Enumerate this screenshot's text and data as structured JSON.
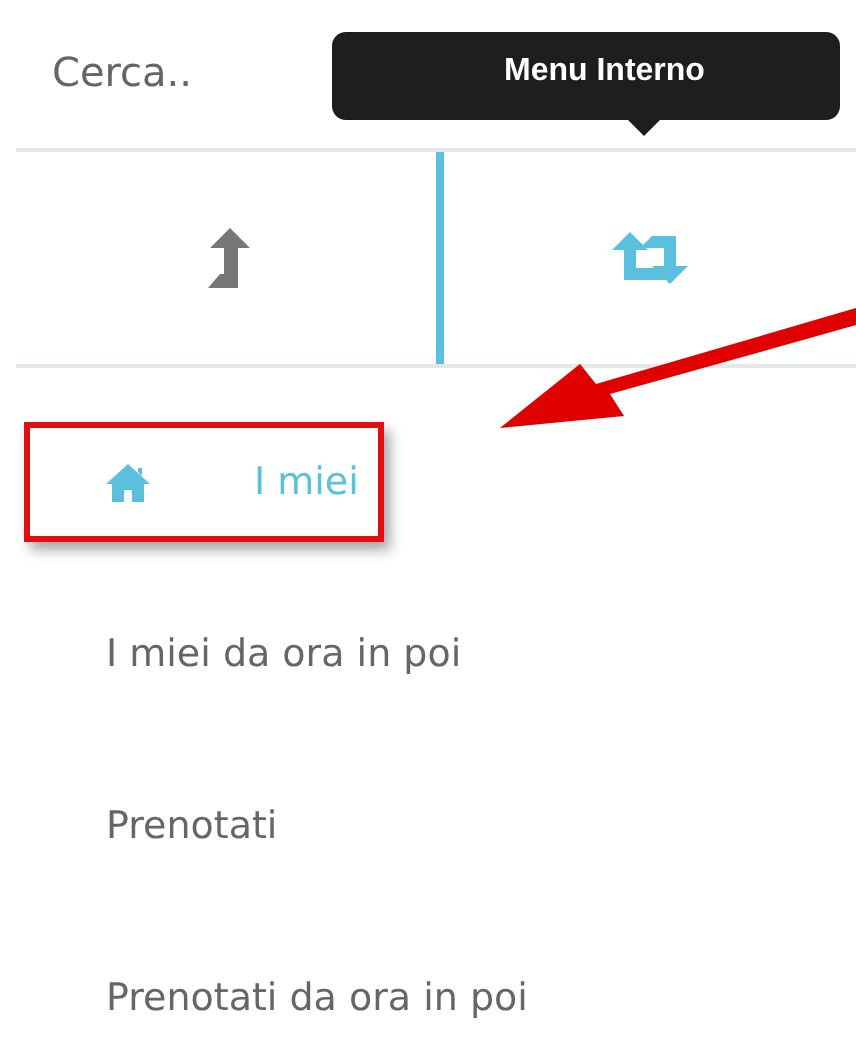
{
  "search": {
    "placeholder": "Cerca.."
  },
  "tooltip": {
    "text": "Menu Interno"
  },
  "tabs": [
    {
      "kind": "up",
      "selected": false
    },
    {
      "kind": "repeat",
      "selected": true
    }
  ],
  "menu": [
    {
      "label": "I miei",
      "kind": "home",
      "selected": true,
      "highlighted": true
    },
    {
      "label": "I miei da ora in poi",
      "selected": false,
      "highlighted": false
    },
    {
      "label": "Prenotati",
      "selected": false,
      "highlighted": false
    },
    {
      "label": "Prenotati da ora in poi",
      "selected": false,
      "highlighted": false
    }
  ]
}
